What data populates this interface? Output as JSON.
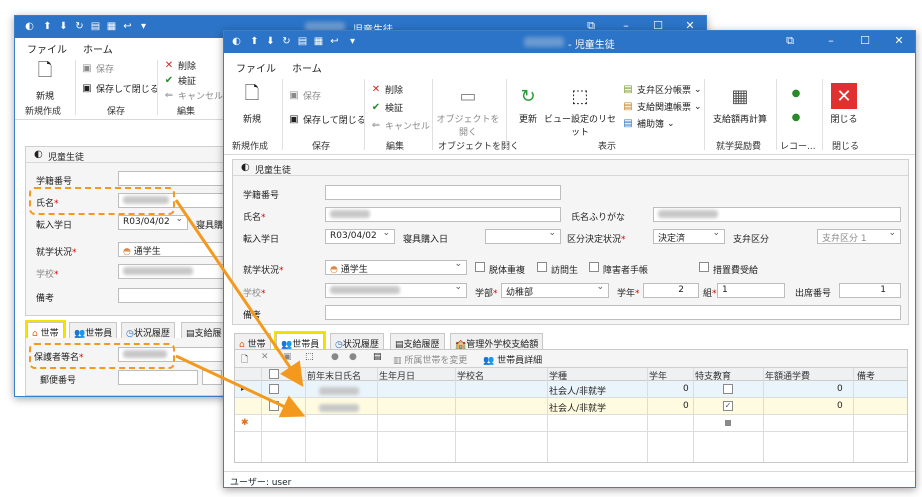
{
  "back_window": {
    "title": "児童生徒",
    "menu": {
      "file": "ファイル",
      "home": "ホーム"
    },
    "ribbon": {
      "new": "新規",
      "save": "保存",
      "save_close": "保存して閉じる",
      "delete": "削除",
      "validate": "検証",
      "cancel": "キャンセル",
      "group_new": "新規作成",
      "group_save": "保存",
      "group_edit": "編集"
    },
    "panel_title": "児童生徒",
    "fields": {
      "student_no": "学籍番号",
      "name": "氏名",
      "entry_date": "転入学日",
      "entry_date_value": "R03/04/02",
      "dorm": "寝具購入",
      "status": "就学状況",
      "status_value": "通学生",
      "school": "学校",
      "remarks": "備考"
    },
    "tabs": [
      "世帯",
      "世帯員",
      "状況履歴",
      "支給履"
    ],
    "lower": {
      "guardian": "保護者等名",
      "postal": "郵便番号"
    }
  },
  "front_window": {
    "title": "- 児童生徒",
    "menu": {
      "file": "ファイル",
      "home": "ホーム"
    },
    "ribbon": {
      "new": "新規",
      "save": "保存",
      "save_close": "保存して閉じる",
      "delete": "削除",
      "validate": "検証",
      "cancel": "キャンセル",
      "open_object": "オブジェクトを開く",
      "refresh": "更新",
      "view_reset": "ビュー設定のリセット",
      "payment_book": "支弁区分帳票",
      "payment_related": "支給関連帳票",
      "aux_book": "補助簿",
      "recalc": "支給額再計算",
      "record_up": "レコー...",
      "close": "閉じる",
      "group_new": "新規作成",
      "group_save": "保存",
      "group_edit": "編集",
      "group_open": "オブジェクトを開く",
      "group_display": "表示",
      "group_aid": "就学奨励費",
      "group_record": "レコー...",
      "group_close": "閉じる"
    },
    "panel_title": "児童生徒",
    "fields": {
      "student_no": "学籍番号",
      "name": "氏名",
      "name_kana": "氏名ふりがな",
      "entry_date": "転入学日",
      "entry_date_value": "R03/04/02",
      "dorm": "寝具購入日",
      "decision": "区分決定状況",
      "decision_value": "決定済",
      "payment_class": "支弁区分",
      "payment_class_value": "支弁区分 1",
      "status": "就学状況",
      "status_value": "通学生",
      "opt1": "脱体重複",
      "opt2": "訪問生",
      "opt3": "障害者手帳",
      "opt4": "措置費受給",
      "school": "学校",
      "dept": "学部",
      "dept_value": "幼稚部",
      "grade": "学年",
      "grade_value": "2",
      "class": "組",
      "class_value": "1",
      "seat": "出席番号",
      "seat_value": "1",
      "remarks": "備考"
    },
    "tabs": [
      "世帯",
      "世帯員",
      "状況履歴",
      "支給履歴",
      "管理外学校支給額"
    ],
    "grid_toolbar": {
      "change_household": "所属世帯を変更",
      "member_detail": "世帯員詳細"
    },
    "grid_columns": [
      "前年末日氏名",
      "生年月日",
      "学校名",
      "学種",
      "学年",
      "特支教育",
      "年額通学費",
      "備考"
    ],
    "grid_rows": [
      {
        "type": "社会人/非就学",
        "grade": "0",
        "special": false,
        "fee": "0"
      },
      {
        "type": "社会人/非就学",
        "grade": "0",
        "special": true,
        "fee": "0"
      }
    ],
    "status": "ユーザー: user"
  }
}
